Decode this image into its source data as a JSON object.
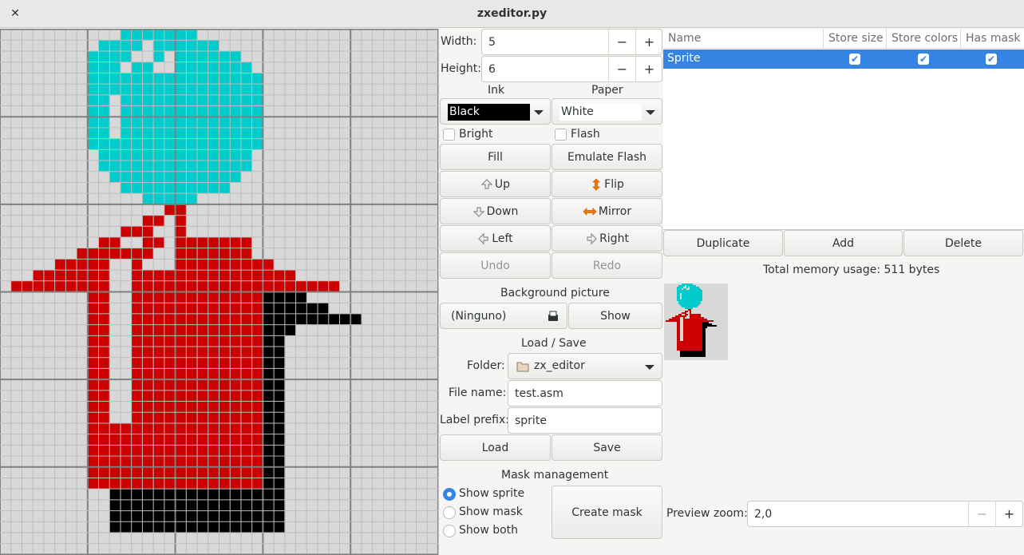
{
  "window": {
    "title": "zxeditor.py",
    "close_label": "✕"
  },
  "size": {
    "width_label": "Width:",
    "width_value": "5",
    "height_label": "Height:",
    "height_value": "6"
  },
  "colors": {
    "ink_label": "Ink",
    "ink_value": "Black",
    "paper_label": "Paper",
    "paper_value": "White",
    "bright_label": "Bright",
    "flash_label": "Flash"
  },
  "actions": {
    "fill": "Fill",
    "emulate_flash": "Emulate Flash",
    "up": "Up",
    "flip": "Flip",
    "down": "Down",
    "mirror": "Mirror",
    "left": "Left",
    "right": "Right",
    "undo": "Undo",
    "redo": "Redo"
  },
  "background": {
    "label": "Background picture",
    "file_value": "(Ninguno)",
    "show": "Show"
  },
  "load_save": {
    "label": "Load / Save",
    "folder_label": "Folder:",
    "folder_value": "zx_editor",
    "file_label": "File name:",
    "file_value": "test.asm",
    "prefix_label": "Label prefix:",
    "prefix_value": "sprite",
    "load": "Load",
    "save": "Save"
  },
  "mask": {
    "label": "Mask management",
    "show_sprite": "Show sprite",
    "show_mask": "Show mask",
    "show_both": "Show both",
    "create_mask": "Create mask",
    "selected": "Show sprite"
  },
  "sprites_table": {
    "columns": [
      "Name",
      "Store size",
      "Store colors",
      "Has mask"
    ],
    "rows": [
      {
        "name": "Sprite",
        "store_size": true,
        "store_colors": true,
        "has_mask": true
      }
    ]
  },
  "list_actions": {
    "duplicate": "Duplicate",
    "add": "Add",
    "delete": "Delete"
  },
  "memory": {
    "text": "Total memory usage: 511 bytes"
  },
  "preview": {
    "zoom_label": "Preview zoom:",
    "zoom_value": "2,0"
  },
  "sprite_colors": {
    "ink": "#cc0000",
    "cyan": "#00cccc",
    "black": "#000000",
    "background": "#d8d8d8",
    "grid": "#bdbdbd",
    "major_grid": "#808080",
    "selection": "#3584e4"
  },
  "icons": {
    "up": "up-arrow-icon",
    "down": "down-arrow-icon",
    "left": "left-arrow-icon",
    "right": "right-arrow-icon",
    "flip": "flip-icon",
    "mirror": "mirror-icon",
    "open": "document-open-icon",
    "folder": "folder-icon"
  }
}
